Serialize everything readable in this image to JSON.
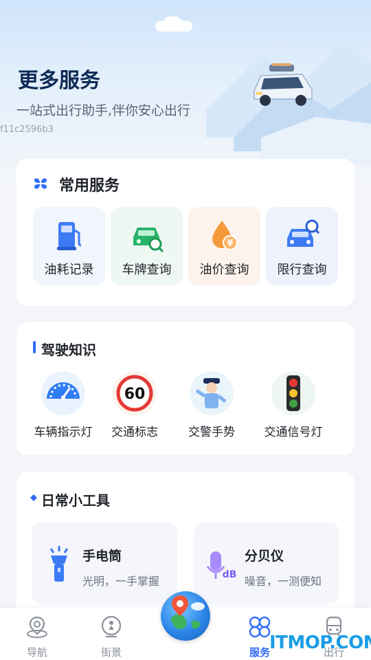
{
  "hero": {
    "title": "更多服务",
    "subtitle": "一站式出行助手,伴你安心出行",
    "id_text": "f11c2596b3"
  },
  "common_services": {
    "title": "常用服务",
    "items": [
      {
        "label": "油耗记录",
        "icon": "fuel-pump-icon"
      },
      {
        "label": "车牌查询",
        "icon": "car-search-icon"
      },
      {
        "label": "油价查询",
        "icon": "oil-price-icon"
      },
      {
        "label": "限行查询",
        "icon": "restriction-search-icon"
      }
    ]
  },
  "driving_knowledge": {
    "title": "驾驶知识",
    "items": [
      {
        "label": "车辆指示灯",
        "icon": "speedometer-icon"
      },
      {
        "label": "交通标志",
        "icon": "speed-limit-sign-icon",
        "sign_text": "60"
      },
      {
        "label": "交警手势",
        "icon": "traffic-police-icon"
      },
      {
        "label": "交通信号灯",
        "icon": "traffic-light-icon"
      }
    ]
  },
  "daily_tools": {
    "title": "日常小工具",
    "items": [
      {
        "name": "手电筒",
        "desc": "光明，一手掌握",
        "icon": "flashlight-icon"
      },
      {
        "name": "分贝仪",
        "desc": "噪音，一测便知",
        "icon": "decibel-meter-icon",
        "icon_text": "dB"
      }
    ]
  },
  "tabbar": {
    "items": [
      {
        "label": "导航",
        "icon": "navigation-icon",
        "active": false
      },
      {
        "label": "街景",
        "icon": "street-view-icon",
        "active": false
      },
      {
        "label": "服务",
        "icon": "services-icon",
        "active": true
      },
      {
        "label": "出行",
        "icon": "train-icon",
        "active": false
      }
    ]
  },
  "watermark": "ITMOP.COM",
  "colors": {
    "accent": "#2f6cf6",
    "title_dark": "#0d2a54",
    "card_bg": "#ffffff",
    "page_bg": "#f3f5f9"
  }
}
